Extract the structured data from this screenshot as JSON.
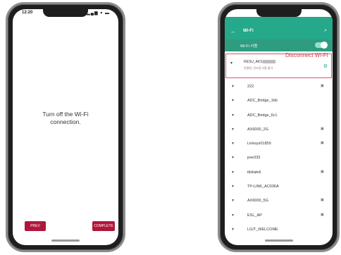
{
  "left_phone": {
    "status_time": "12:20",
    "status_icons": "▂▄▆ ▾ ▬",
    "message_line1": "Turn off the Wi-Fi",
    "message_line2": "connection.",
    "prev_label": "PREV",
    "complete_label": "COMPLETE"
  },
  "right_phone": {
    "status_time": "12:20",
    "status_icons": "▂▄▆ ▾ ▬",
    "title": "Wi-Fi",
    "back_icon": "←",
    "search_icon": "⌕",
    "toggle_label": "Wi-Fi 사용",
    "toggle_on": true,
    "connected": {
      "ssid": "RESU_AKS",
      "status": "연결됨, 인터넷 사용 불가"
    },
    "disconnect_label": "Disconnect Wi-Fi",
    "networks": [
      {
        "name": "222",
        "locked": true
      },
      {
        "name": "ADC_Bridge_1bb",
        "locked": false
      },
      {
        "name": "ADC_Bridge_6c1",
        "locked": false
      },
      {
        "name": "AX6000_2G",
        "locked": true
      },
      {
        "name": "Linksys01859",
        "locked": true
      },
      {
        "name": "poe333",
        "locked": false
      },
      {
        "name": "tlb4afe6",
        "locked": true
      },
      {
        "name": "TP-LINK_AC036A",
        "locked": false
      },
      {
        "name": "AX6000_5G",
        "locked": true
      },
      {
        "name": "ESL_AP",
        "locked": true
      },
      {
        "name": "LGIT_WELCOME",
        "locked": false
      }
    ]
  },
  "colors": {
    "accent_red": "#b0173a",
    "appbar_teal": "#26a88a",
    "highlight_red": "#d9566e"
  }
}
